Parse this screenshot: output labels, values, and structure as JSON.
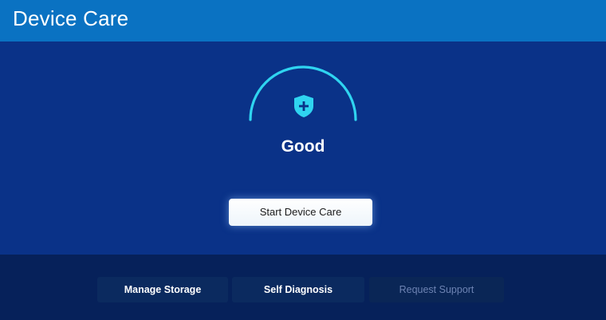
{
  "header": {
    "title": "Device Care"
  },
  "status": {
    "label": "Good",
    "icon": "shield-plus-icon",
    "accent_color": "#2fd4f0"
  },
  "actions": {
    "start_label": "Start Device Care"
  },
  "bottom_menu": {
    "items": [
      {
        "label": "Manage Storage",
        "enabled": true
      },
      {
        "label": "Self Diagnosis",
        "enabled": true
      },
      {
        "label": "Request Support",
        "enabled": false
      }
    ]
  },
  "colors": {
    "header_bg": "#0a72c2",
    "main_bg": "#0a3288",
    "bottom_bg": "#06215a"
  }
}
